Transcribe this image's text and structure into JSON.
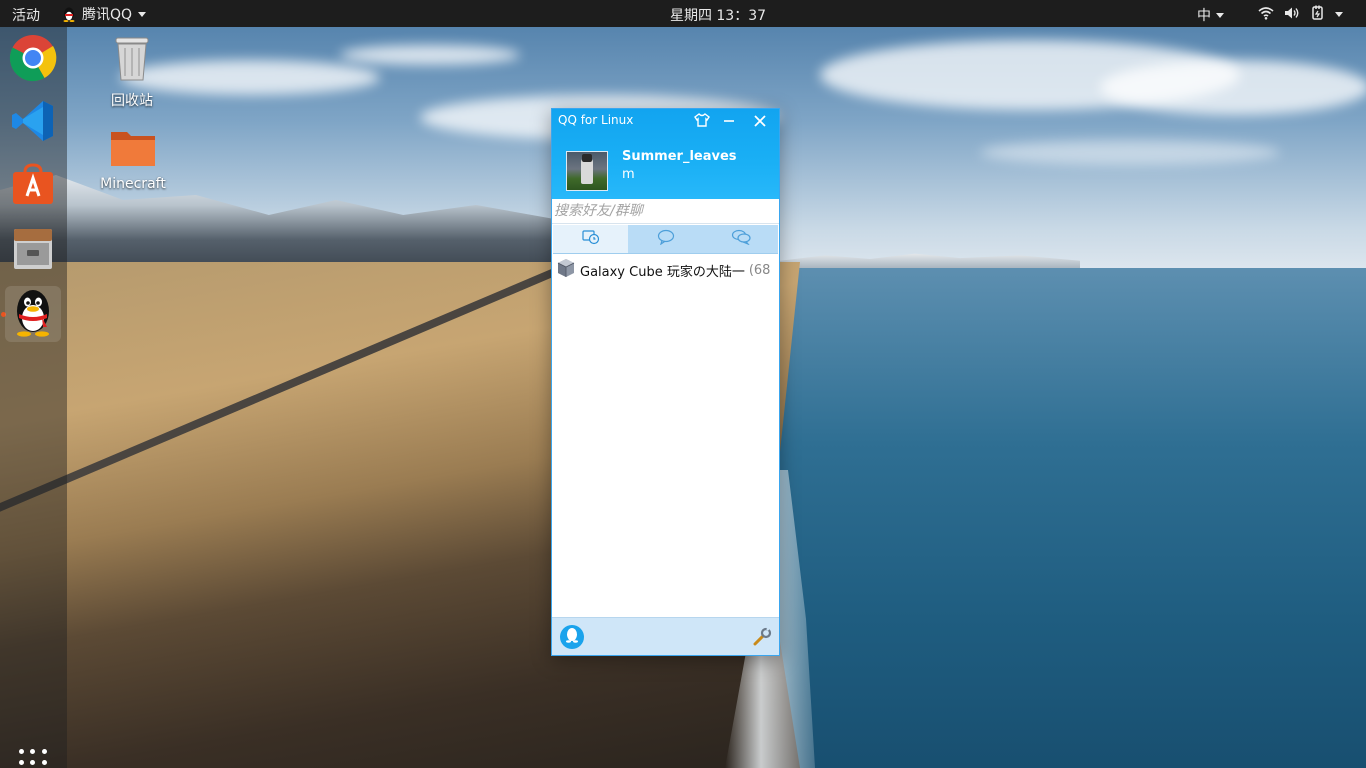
{
  "topbar": {
    "activities": "活动",
    "app_name": "腾讯QQ",
    "clock": "星期四 13：37",
    "input_method": "中",
    "tray_icons": [
      "wifi-icon",
      "volume-icon",
      "power-icon"
    ]
  },
  "dock": {
    "items": [
      "chrome-icon",
      "vscode-icon",
      "software-center-icon",
      "file-cabinet-icon",
      "qq-penguin-icon"
    ],
    "apps_grid": "show-applications-icon"
  },
  "desktop": {
    "icons": [
      {
        "label": "回收站",
        "icon": "trash-icon"
      },
      {
        "label": "Minecraft",
        "icon": "folder-icon"
      }
    ]
  },
  "qq_window": {
    "title": "QQ for Linux",
    "controls": [
      "skin-icon",
      "minimize-icon",
      "close-icon"
    ],
    "profile": {
      "nickname": "Summer_leaves",
      "signature": "m"
    },
    "search_placeholder": "搜索好友/群聊",
    "tabs": [
      {
        "icon": "recent-chats-icon",
        "active": true
      },
      {
        "icon": "contacts-bubble-icon",
        "active": false
      },
      {
        "icon": "group-chats-icon",
        "active": false
      }
    ],
    "list": [
      {
        "name": "Galaxy Cube 玩家の大陆一",
        "count": "(68"
      }
    ],
    "footer": {
      "menu_icon": "qq-main-menu-icon",
      "tool_icon": "settings-wrench-icon"
    }
  },
  "colors": {
    "qq_header": "#12a4f0",
    "qq_tab_bar": "#b9dcf6",
    "topbar": "#1d1d1d",
    "running_indicator": "#e95420"
  }
}
